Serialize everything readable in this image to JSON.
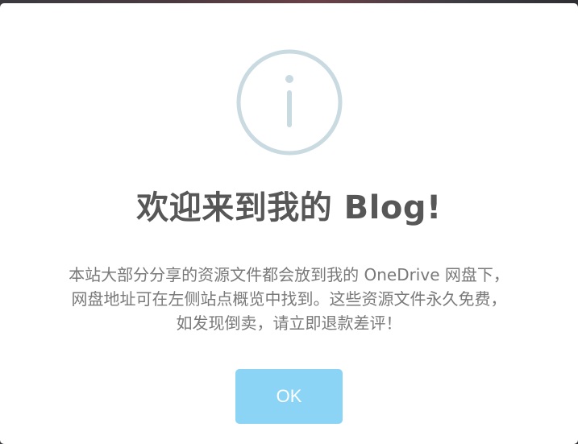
{
  "dialog": {
    "icon": "info-icon",
    "title": "欢迎来到我的 Blog!",
    "message_lines": [
      "本站大部分分享的资源文件都会放到我的 OneDrive 网盘下，",
      "网盘地址可在左侧站点概览中找到。这些资源文件永久免费，",
      "如发现倒卖，请立即退款差评！"
    ],
    "confirm_label": "OK"
  },
  "colors": {
    "icon_stroke": "#c9dae1",
    "title": "#575757",
    "message": "#797979",
    "button_bg": "#8cd4f5",
    "button_text": "#ffffff"
  }
}
